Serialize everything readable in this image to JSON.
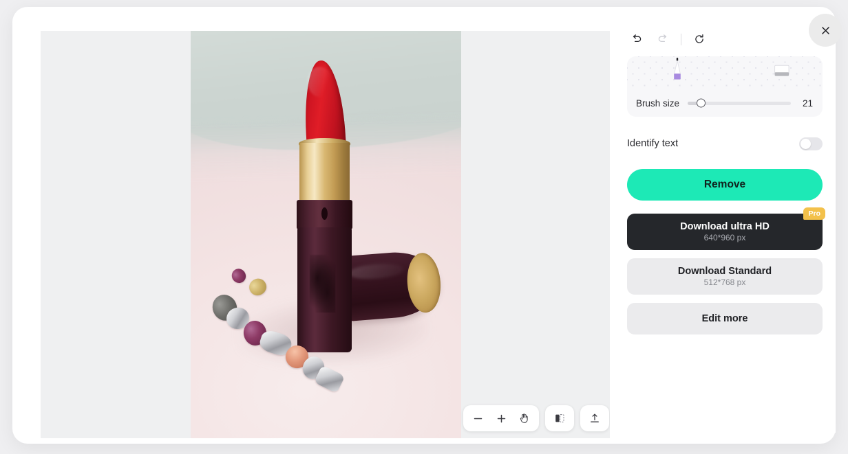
{
  "window": {
    "close_button_icon": "close-icon"
  },
  "canvas": {
    "image_alt": "Red lipstick tube with gold barrel standing beside a dark lying cap and a silver gem bracelet on pink surface",
    "bottom_toolbar": {
      "zoom_out_icon": "minus-icon",
      "zoom_in_icon": "plus-icon",
      "pan_icon": "hand-icon",
      "compare_icon": "compare-split-icon",
      "upload_icon": "upload-icon"
    }
  },
  "panel": {
    "history": {
      "undo_icon": "undo-icon",
      "redo_icon": "redo-icon",
      "reset_icon": "reset-icon",
      "undo_enabled": "true",
      "redo_enabled": "false",
      "reset_enabled": "true"
    },
    "brush_card": {
      "marker_icon": "marker-brush-icon",
      "eraser_icon": "eraser-icon",
      "selected_tool": "marker-brush-icon",
      "slider_label": "Brush size",
      "slider_value": "21",
      "slider_min": "1",
      "slider_max": "100",
      "slider_fill_percent": "13"
    },
    "identify_text": {
      "label": "Identify text",
      "toggle_state": "off"
    },
    "remove_button": {
      "label": "Remove",
      "color": "#1de9b6"
    },
    "download_ultra_hd": {
      "title": "Download ultra HD",
      "subtitle": "640*960 px",
      "badge": "Pro",
      "badge_color": "#f3c14b",
      "background": "#25272b"
    },
    "download_standard": {
      "title": "Download Standard",
      "subtitle": "512*768 px",
      "background": "#ebebed"
    },
    "edit_more": {
      "title": "Edit more",
      "background": "#ebebed"
    }
  }
}
